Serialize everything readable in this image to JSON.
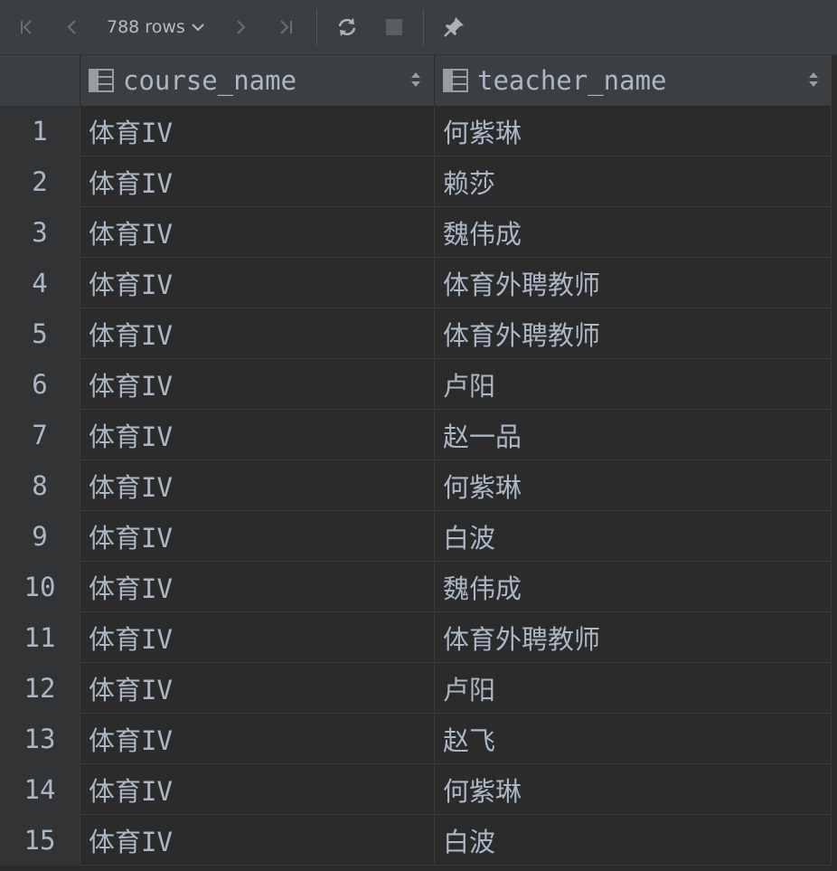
{
  "toolbar": {
    "rows_label": "788 rows",
    "icons": [
      "first-page-icon",
      "previous-page-icon",
      "chevron-down-icon",
      "next-page-icon",
      "last-page-icon",
      "refresh-icon",
      "stop-icon",
      "pin-icon"
    ]
  },
  "colors": {
    "background": "#2b2b2b",
    "toolbar": "#3c3f41",
    "gutter": "#313335",
    "text": "#a9b7c6",
    "grid_line": "#3a3a3a"
  },
  "columns": [
    {
      "label": "course_name"
    },
    {
      "label": "teacher_name"
    }
  ],
  "rows": [
    {
      "num": "1",
      "course_name": "体育IV",
      "teacher_name": "何紫琳"
    },
    {
      "num": "2",
      "course_name": "体育IV",
      "teacher_name": "赖莎"
    },
    {
      "num": "3",
      "course_name": "体育IV",
      "teacher_name": "魏伟成"
    },
    {
      "num": "4",
      "course_name": "体育IV",
      "teacher_name": "体育外聘教师"
    },
    {
      "num": "5",
      "course_name": "体育IV",
      "teacher_name": "体育外聘教师"
    },
    {
      "num": "6",
      "course_name": "体育IV",
      "teacher_name": "卢阳"
    },
    {
      "num": "7",
      "course_name": "体育IV",
      "teacher_name": "赵一品"
    },
    {
      "num": "8",
      "course_name": "体育IV",
      "teacher_name": "何紫琳"
    },
    {
      "num": "9",
      "course_name": "体育IV",
      "teacher_name": "白波"
    },
    {
      "num": "10",
      "course_name": "体育IV",
      "teacher_name": "魏伟成"
    },
    {
      "num": "11",
      "course_name": "体育IV",
      "teacher_name": "体育外聘教师"
    },
    {
      "num": "12",
      "course_name": "体育IV",
      "teacher_name": "卢阳"
    },
    {
      "num": "13",
      "course_name": "体育IV",
      "teacher_name": "赵飞"
    },
    {
      "num": "14",
      "course_name": "体育IV",
      "teacher_name": "何紫琳"
    },
    {
      "num": "15",
      "course_name": "体育IV",
      "teacher_name": "白波"
    }
  ]
}
